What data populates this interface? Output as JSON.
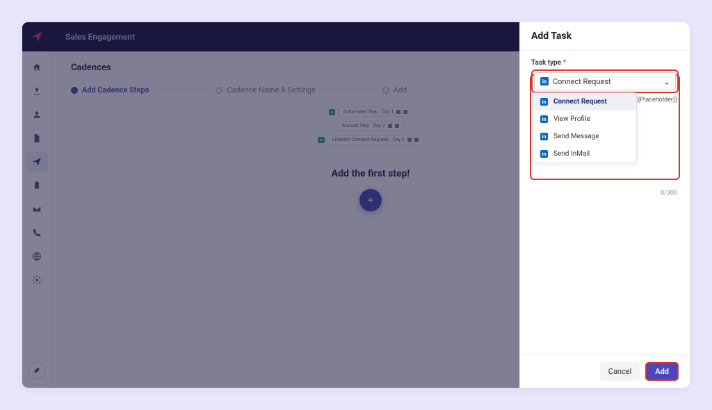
{
  "topbar": {
    "title": "Sales Engagement"
  },
  "page": {
    "title": "Cadences"
  },
  "steps": {
    "s1": "Add Cadence Steps",
    "s2": "Cadence Name & Settings",
    "s3": "Add"
  },
  "preview": {
    "row1_badge": "●",
    "row1_text": "Automated Step · Day 1",
    "row2_text": "Manual Step · Day 2",
    "row3_badge": "●",
    "row3_text": "LinkedIn Connect Request · Day 3"
  },
  "main": {
    "add_first": "Add the first step!"
  },
  "panel": {
    "title": "Add Task",
    "field_label": "Task type",
    "required": "*",
    "selected": "Connect Request",
    "placeholder_chip": "{{Placeholder}}",
    "char_count": "0/300",
    "options": {
      "o1": "Connect Request",
      "o2": "View Profile",
      "o3": "Send Message",
      "o4": "Send InMail"
    },
    "cancel": "Cancel",
    "add": "Add"
  }
}
